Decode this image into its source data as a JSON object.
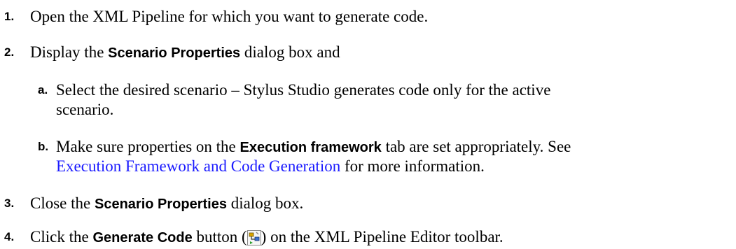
{
  "steps": [
    {
      "num": "1.",
      "text": "Open the XML Pipeline for which you want to generate code."
    },
    {
      "num": "2.",
      "pre": "Display the ",
      "bold": "Scenario Properties",
      "post": " dialog box and",
      "sub": [
        {
          "num": "a.",
          "line1": "Select the desired scenario – Stylus Studio generates code only for the active",
          "line2": "scenario."
        },
        {
          "num": "b.",
          "pre": "Make sure properties on the ",
          "bold": "Execution framework",
          "post": " tab are set appropriately. See",
          "link": "Execution Framework and Code Generation",
          "post2": " for more information."
        }
      ]
    },
    {
      "num": "3.",
      "pre": "Close the ",
      "bold": "Scenario Properties",
      "post": " dialog box."
    },
    {
      "num": "4.",
      "pre": "Click the ",
      "bold": "Generate Code",
      "mid": " button (",
      "icon": "generate-code-icon",
      "post": ") on the XML Pipeline Editor toolbar."
    }
  ]
}
